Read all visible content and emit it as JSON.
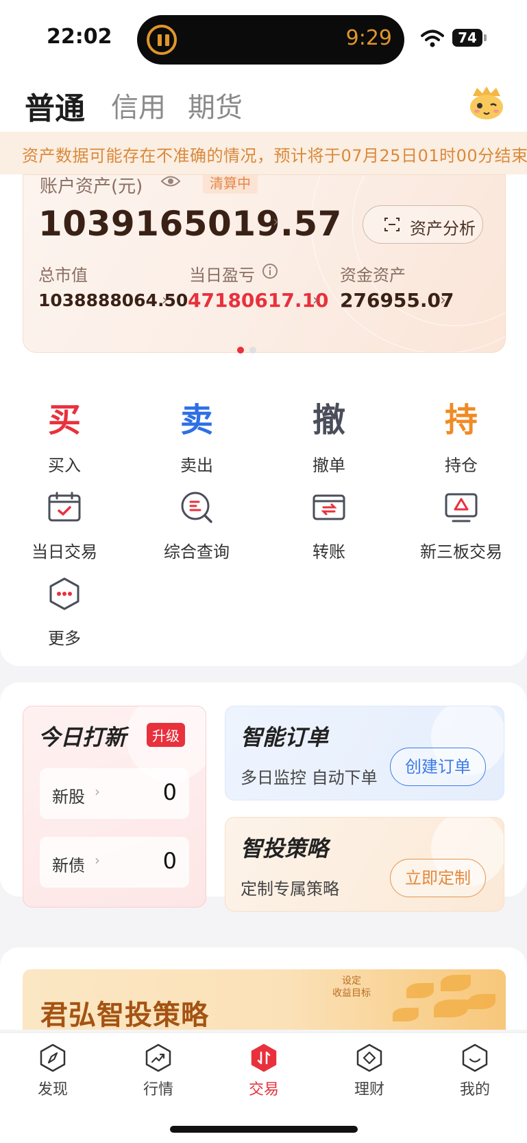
{
  "status_bar": {
    "time": "22:02",
    "timer": "9:29",
    "battery": "74"
  },
  "tabs": [
    {
      "label": "普通",
      "active": true
    },
    {
      "label": "信用",
      "active": false
    },
    {
      "label": "期货",
      "active": false
    }
  ],
  "notice": {
    "text": "资产数据可能存在不准确的情况，预计将于07月25日01时00分结束"
  },
  "account": {
    "label": "账户资产(元)",
    "status": "清算中",
    "total": "1039165019.57",
    "analysis_button": "资产分析",
    "metrics": [
      {
        "label": "总市值",
        "value": "1038888064.50"
      },
      {
        "label": "当日盈亏",
        "value": "47180617.10"
      },
      {
        "label": "资金资产",
        "value": "276955.07"
      }
    ]
  },
  "functions": {
    "buy": {
      "glyph": "买",
      "label": "买入",
      "color": "#e8313d"
    },
    "sell": {
      "glyph": "卖",
      "label": "卖出",
      "color": "#2f6fe6"
    },
    "cancel": {
      "glyph": "撤",
      "label": "撤单",
      "color": "#4a4e5a"
    },
    "hold": {
      "glyph": "持",
      "label": "持仓",
      "color": "#f08a24"
    },
    "today": {
      "label": "当日交易"
    },
    "query": {
      "label": "综合查询"
    },
    "transfer": {
      "label": "转账"
    },
    "neeq": {
      "label": "新三板交易"
    },
    "more": {
      "label": "更多"
    }
  },
  "ipo": {
    "title": "今日打新",
    "badge": "升级",
    "rows": [
      {
        "label": "新股",
        "count": "0"
      },
      {
        "label": "新债",
        "count": "0"
      }
    ]
  },
  "smart_order": {
    "title": "智能订单",
    "subtitle": "多日监控 自动下单",
    "button": "创建订单"
  },
  "smart_strategy": {
    "title": "智投策略",
    "subtitle": "定制专属策略",
    "button": "立即定制"
  },
  "banner": {
    "title": "君弘智投策略",
    "tag_line1": "设定",
    "tag_line2": "收益目标"
  },
  "bottom_nav": [
    {
      "label": "发现",
      "icon": "compass-icon"
    },
    {
      "label": "行情",
      "icon": "trend-icon"
    },
    {
      "label": "交易",
      "icon": "trade-icon",
      "active": true
    },
    {
      "label": "理财",
      "icon": "wealth-icon"
    },
    {
      "label": "我的",
      "icon": "profile-icon"
    }
  ],
  "colors": {
    "accent": "#e8313d",
    "blue": "#3c7be8",
    "orange": "#e38a3d"
  }
}
